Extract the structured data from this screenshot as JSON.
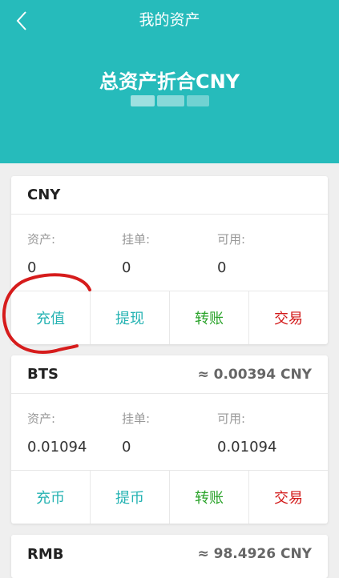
{
  "nav": {
    "title": "我的资产",
    "back_icon": "chevron-left-icon"
  },
  "total": {
    "label": "总资产折合CNY"
  },
  "colors": {
    "header": "#26bbbb",
    "teal": "#26b3b3",
    "green": "#2aa32a",
    "red": "#d21919",
    "annotation": "#d61c1c"
  },
  "cards": [
    {
      "code": "CNY",
      "rate": "",
      "stats": [
        {
          "label": "资产:",
          "value": "0"
        },
        {
          "label": "挂单:",
          "value": "0"
        },
        {
          "label": "可用:",
          "value": "0"
        }
      ],
      "actions": [
        "充值",
        "提现",
        "转账",
        "交易"
      ]
    },
    {
      "code": "BTS",
      "rate": "≈ 0.00394 CNY",
      "stats": [
        {
          "label": "资产:",
          "value": "0.01094"
        },
        {
          "label": "挂单:",
          "value": "0"
        },
        {
          "label": "可用:",
          "value": "0.01094"
        }
      ],
      "actions": [
        "充币",
        "提币",
        "转账",
        "交易"
      ]
    },
    {
      "code": "RMB",
      "rate": "≈ 98.4926 CNY"
    }
  ]
}
